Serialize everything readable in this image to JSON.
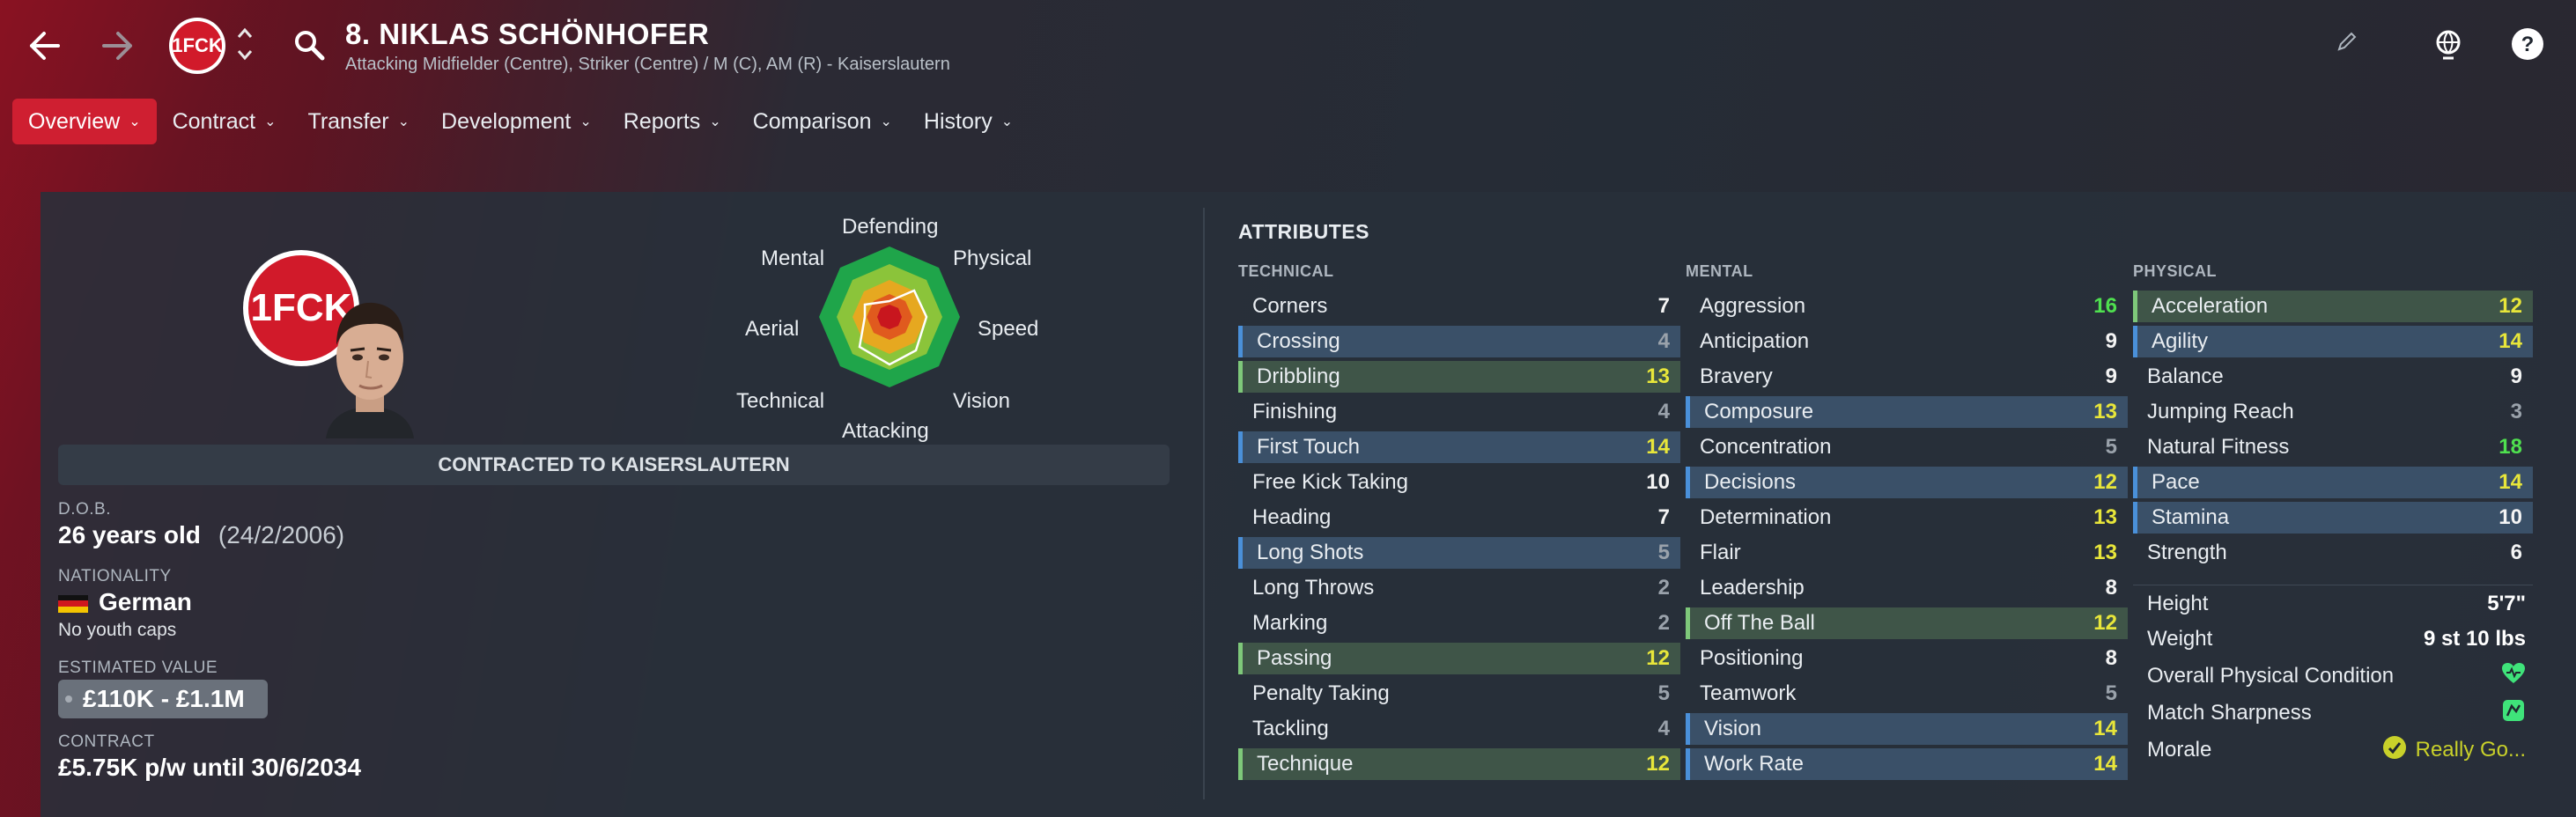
{
  "header": {
    "player_title": "8. NIKLAS SCHÖNHOFER",
    "player_sub": "Attacking Midfielder (Centre), Striker (Centre) / M (C), AM (R) - Kaiserslautern",
    "club_badge_text": "1FCK"
  },
  "tabs": [
    {
      "label": "Overview"
    },
    {
      "label": "Contract"
    },
    {
      "label": "Transfer"
    },
    {
      "label": "Development"
    },
    {
      "label": "Reports"
    },
    {
      "label": "Comparison"
    },
    {
      "label": "History"
    }
  ],
  "profile": {
    "contracted_banner": "CONTRACTED TO KAISERSLAUTERN",
    "dob_label": "D.O.B.",
    "age": "26 years old",
    "dob": "(24/2/2006)",
    "nationality_label": "NATIONALITY",
    "nationality": "German",
    "youth_caps": "No youth caps",
    "value_label": "ESTIMATED VALUE",
    "value": "£110K - £1.1M",
    "contract_label": "CONTRACT",
    "contract": "£5.75K p/w until 30/6/2034"
  },
  "radar": {
    "labels": [
      "Defending",
      "Physical",
      "Speed",
      "Vision",
      "Attacking",
      "Technical",
      "Aerial",
      "Mental"
    ]
  },
  "attributes": {
    "title": "ATTRIBUTES",
    "technical_title": "TECHNICAL",
    "mental_title": "MENTAL",
    "physical_title": "PHYSICAL",
    "technical": [
      {
        "name": "Corners",
        "value": "7"
      },
      {
        "name": "Crossing",
        "value": "4"
      },
      {
        "name": "Dribbling",
        "value": "13"
      },
      {
        "name": "Finishing",
        "value": "4"
      },
      {
        "name": "First Touch",
        "value": "14"
      },
      {
        "name": "Free Kick Taking",
        "value": "10"
      },
      {
        "name": "Heading",
        "value": "7"
      },
      {
        "name": "Long Shots",
        "value": "5"
      },
      {
        "name": "Long Throws",
        "value": "2"
      },
      {
        "name": "Marking",
        "value": "2"
      },
      {
        "name": "Passing",
        "value": "12"
      },
      {
        "name": "Penalty Taking",
        "value": "5"
      },
      {
        "name": "Tackling",
        "value": "4"
      },
      {
        "name": "Technique",
        "value": "12"
      }
    ],
    "mental": [
      {
        "name": "Aggression",
        "value": "16"
      },
      {
        "name": "Anticipation",
        "value": "9"
      },
      {
        "name": "Bravery",
        "value": "9"
      },
      {
        "name": "Composure",
        "value": "13"
      },
      {
        "name": "Concentration",
        "value": "5"
      },
      {
        "name": "Decisions",
        "value": "12"
      },
      {
        "name": "Determination",
        "value": "13"
      },
      {
        "name": "Flair",
        "value": "13"
      },
      {
        "name": "Leadership",
        "value": "8"
      },
      {
        "name": "Off The Ball",
        "value": "12"
      },
      {
        "name": "Positioning",
        "value": "8"
      },
      {
        "name": "Teamwork",
        "value": "5"
      },
      {
        "name": "Vision",
        "value": "14"
      },
      {
        "name": "Work Rate",
        "value": "14"
      }
    ],
    "physical": [
      {
        "name": "Acceleration",
        "value": "12"
      },
      {
        "name": "Agility",
        "value": "14"
      },
      {
        "name": "Balance",
        "value": "9"
      },
      {
        "name": "Jumping Reach",
        "value": "3"
      },
      {
        "name": "Natural Fitness",
        "value": "18"
      },
      {
        "name": "Pace",
        "value": "14"
      },
      {
        "name": "Stamina",
        "value": "10"
      },
      {
        "name": "Strength",
        "value": "6"
      }
    ],
    "physical_extra": {
      "height_label": "Height",
      "height": "5'7\"",
      "weight_label": "Weight",
      "weight": "9 st 10 lbs",
      "condition_label": "Overall Physical Condition",
      "sharpness_label": "Match Sharpness",
      "morale_label": "Morale",
      "morale": "Really Go..."
    }
  },
  "colors": {
    "accent_red": "#cf1f31",
    "highlight_green": "#4fe04f",
    "highlight_yellow": "#e8e63a",
    "morale_yellow": "#c9d12a"
  }
}
